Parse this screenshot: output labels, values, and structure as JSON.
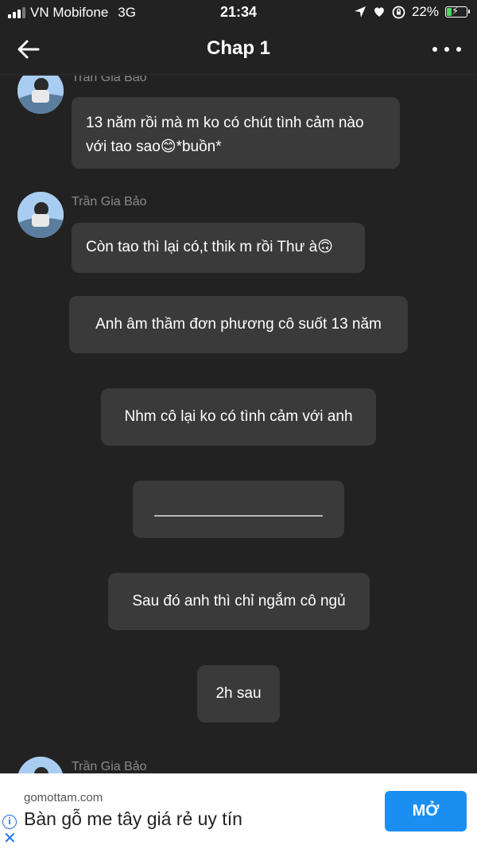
{
  "status_bar": {
    "carrier": "VN Mobifone",
    "network": "3G",
    "time": "21:34",
    "battery_percent": "22%",
    "battery_level": 0.22,
    "icons": [
      "signal-icon",
      "location-arrow-icon",
      "heart-icon",
      "rotation-lock-icon",
      "battery-charging-icon"
    ]
  },
  "header": {
    "title": "Chap 1",
    "back_icon": "back-arrow-icon",
    "more_icon": "more-dots-icon"
  },
  "messages": [
    {
      "sender": "Trần Gia Bảo",
      "text": "13 năm rồi mà m ko có chút tình cảm nào với tao sao😊*buồn*",
      "style": "left"
    },
    {
      "sender": "Trần Gia Bảo",
      "text": "Còn tao thì lại có,t thik m rồi Thư à🙃",
      "style": "left"
    },
    {
      "text": "Anh âm thầm đơn phương cô suốt 13 năm",
      "style": "center"
    },
    {
      "text": "Nhm cô lại ko có tình cảm với anh",
      "style": "center"
    },
    {
      "text": "____________________",
      "style": "center"
    },
    {
      "text": "Sau đó anh thì chỉ ngắm cô ngủ",
      "style": "center"
    },
    {
      "text": "2h sau",
      "style": "center"
    },
    {
      "sender": "Trần Gia Bảo",
      "text": "",
      "style": "left"
    }
  ],
  "ad": {
    "domain": "gomottam.com",
    "headline": "Bàn gỗ me tây giá rẻ uy tín",
    "cta": "MỞ",
    "info_icon": "ⓘ",
    "close_icon": "✕",
    "cta_color": "#1a8ff1"
  },
  "colors": {
    "background": "#222222",
    "bubble": "#3a3a3a",
    "sender_name": "#8a8a8a",
    "battery_fill": "#4cd964"
  }
}
